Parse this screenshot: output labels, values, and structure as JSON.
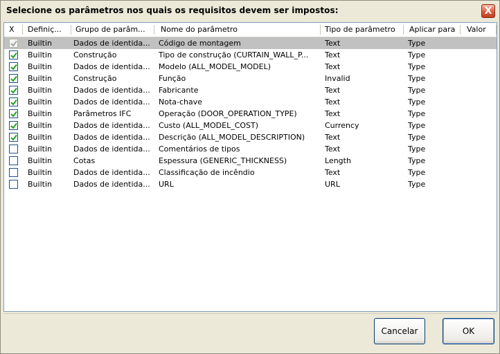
{
  "dialog": {
    "title": "Selecione os parâmetros nos quais os requisitos devem ser impostos:",
    "close_glyph": "X"
  },
  "columns": [
    "X",
    "Definiç...",
    "Grupo de parâm...",
    "Nome do parâmetro",
    "Tipo de parâmetro",
    "Aplicar para",
    "Valor"
  ],
  "rows": [
    {
      "checked": true,
      "disabled": true,
      "selected": true,
      "definition": "Builtin",
      "group": "Dados de identida...",
      "name": "Código de montagem",
      "type": "Text",
      "apply": "Type",
      "value": ""
    },
    {
      "checked": true,
      "definition": "Builtin",
      "group": "Construção",
      "name": "Tipo de construção (CURTAIN_WALL_P...",
      "type": "Text",
      "apply": "Type",
      "value": ""
    },
    {
      "checked": true,
      "definition": "Builtin",
      "group": "Dados de identida...",
      "name": "Modelo (ALL_MODEL_MODEL)",
      "type": "Text",
      "apply": "Type",
      "value": ""
    },
    {
      "checked": true,
      "definition": "Builtin",
      "group": "Construção",
      "name": "Função",
      "type": "Invalid",
      "apply": "Type",
      "value": ""
    },
    {
      "checked": true,
      "definition": "Builtin",
      "group": "Dados de identida...",
      "name": "Fabricante",
      "type": "Text",
      "apply": "Type",
      "value": ""
    },
    {
      "checked": true,
      "definition": "Builtin",
      "group": "Dados de identida...",
      "name": "Nota-chave",
      "type": "Text",
      "apply": "Type",
      "value": ""
    },
    {
      "checked": true,
      "definition": "Builtin",
      "group": "Parâmetros IFC",
      "name": "Operação (DOOR_OPERATION_TYPE)",
      "type": "Text",
      "apply": "Type",
      "value": ""
    },
    {
      "checked": true,
      "definition": "Builtin",
      "group": "Dados de identida...",
      "name": "Custo (ALL_MODEL_COST)",
      "type": "Currency",
      "apply": "Type",
      "value": ""
    },
    {
      "checked": true,
      "definition": "Builtin",
      "group": "Dados de identida...",
      "name": "Descrição (ALL_MODEL_DESCRIPTION)",
      "type": "Text",
      "apply": "Type",
      "value": ""
    },
    {
      "checked": false,
      "definition": "Builtin",
      "group": "Dados de identida...",
      "name": "Comentários de tipos",
      "type": "Text",
      "apply": "Type",
      "value": ""
    },
    {
      "checked": false,
      "definition": "Builtin",
      "group": "Cotas",
      "name": "Espessura (GENERIC_THICKNESS)",
      "type": "Length",
      "apply": "Type",
      "value": ""
    },
    {
      "checked": false,
      "definition": "Builtin",
      "group": "Dados de identida...",
      "name": "Classificação de incêndio",
      "type": "Text",
      "apply": "Type",
      "value": ""
    },
    {
      "checked": false,
      "definition": "Builtin",
      "group": "Dados de identida...",
      "name": "URL",
      "type": "URL",
      "apply": "Type",
      "value": ""
    }
  ],
  "buttons": {
    "cancel": "Cancelar",
    "ok": "OK"
  },
  "colors": {
    "selected_row": "#c1c1c1",
    "checkmark": "#21a121",
    "checkmark_disabled": "#a3a3a3",
    "dialog_bg": "#ece9d8"
  }
}
